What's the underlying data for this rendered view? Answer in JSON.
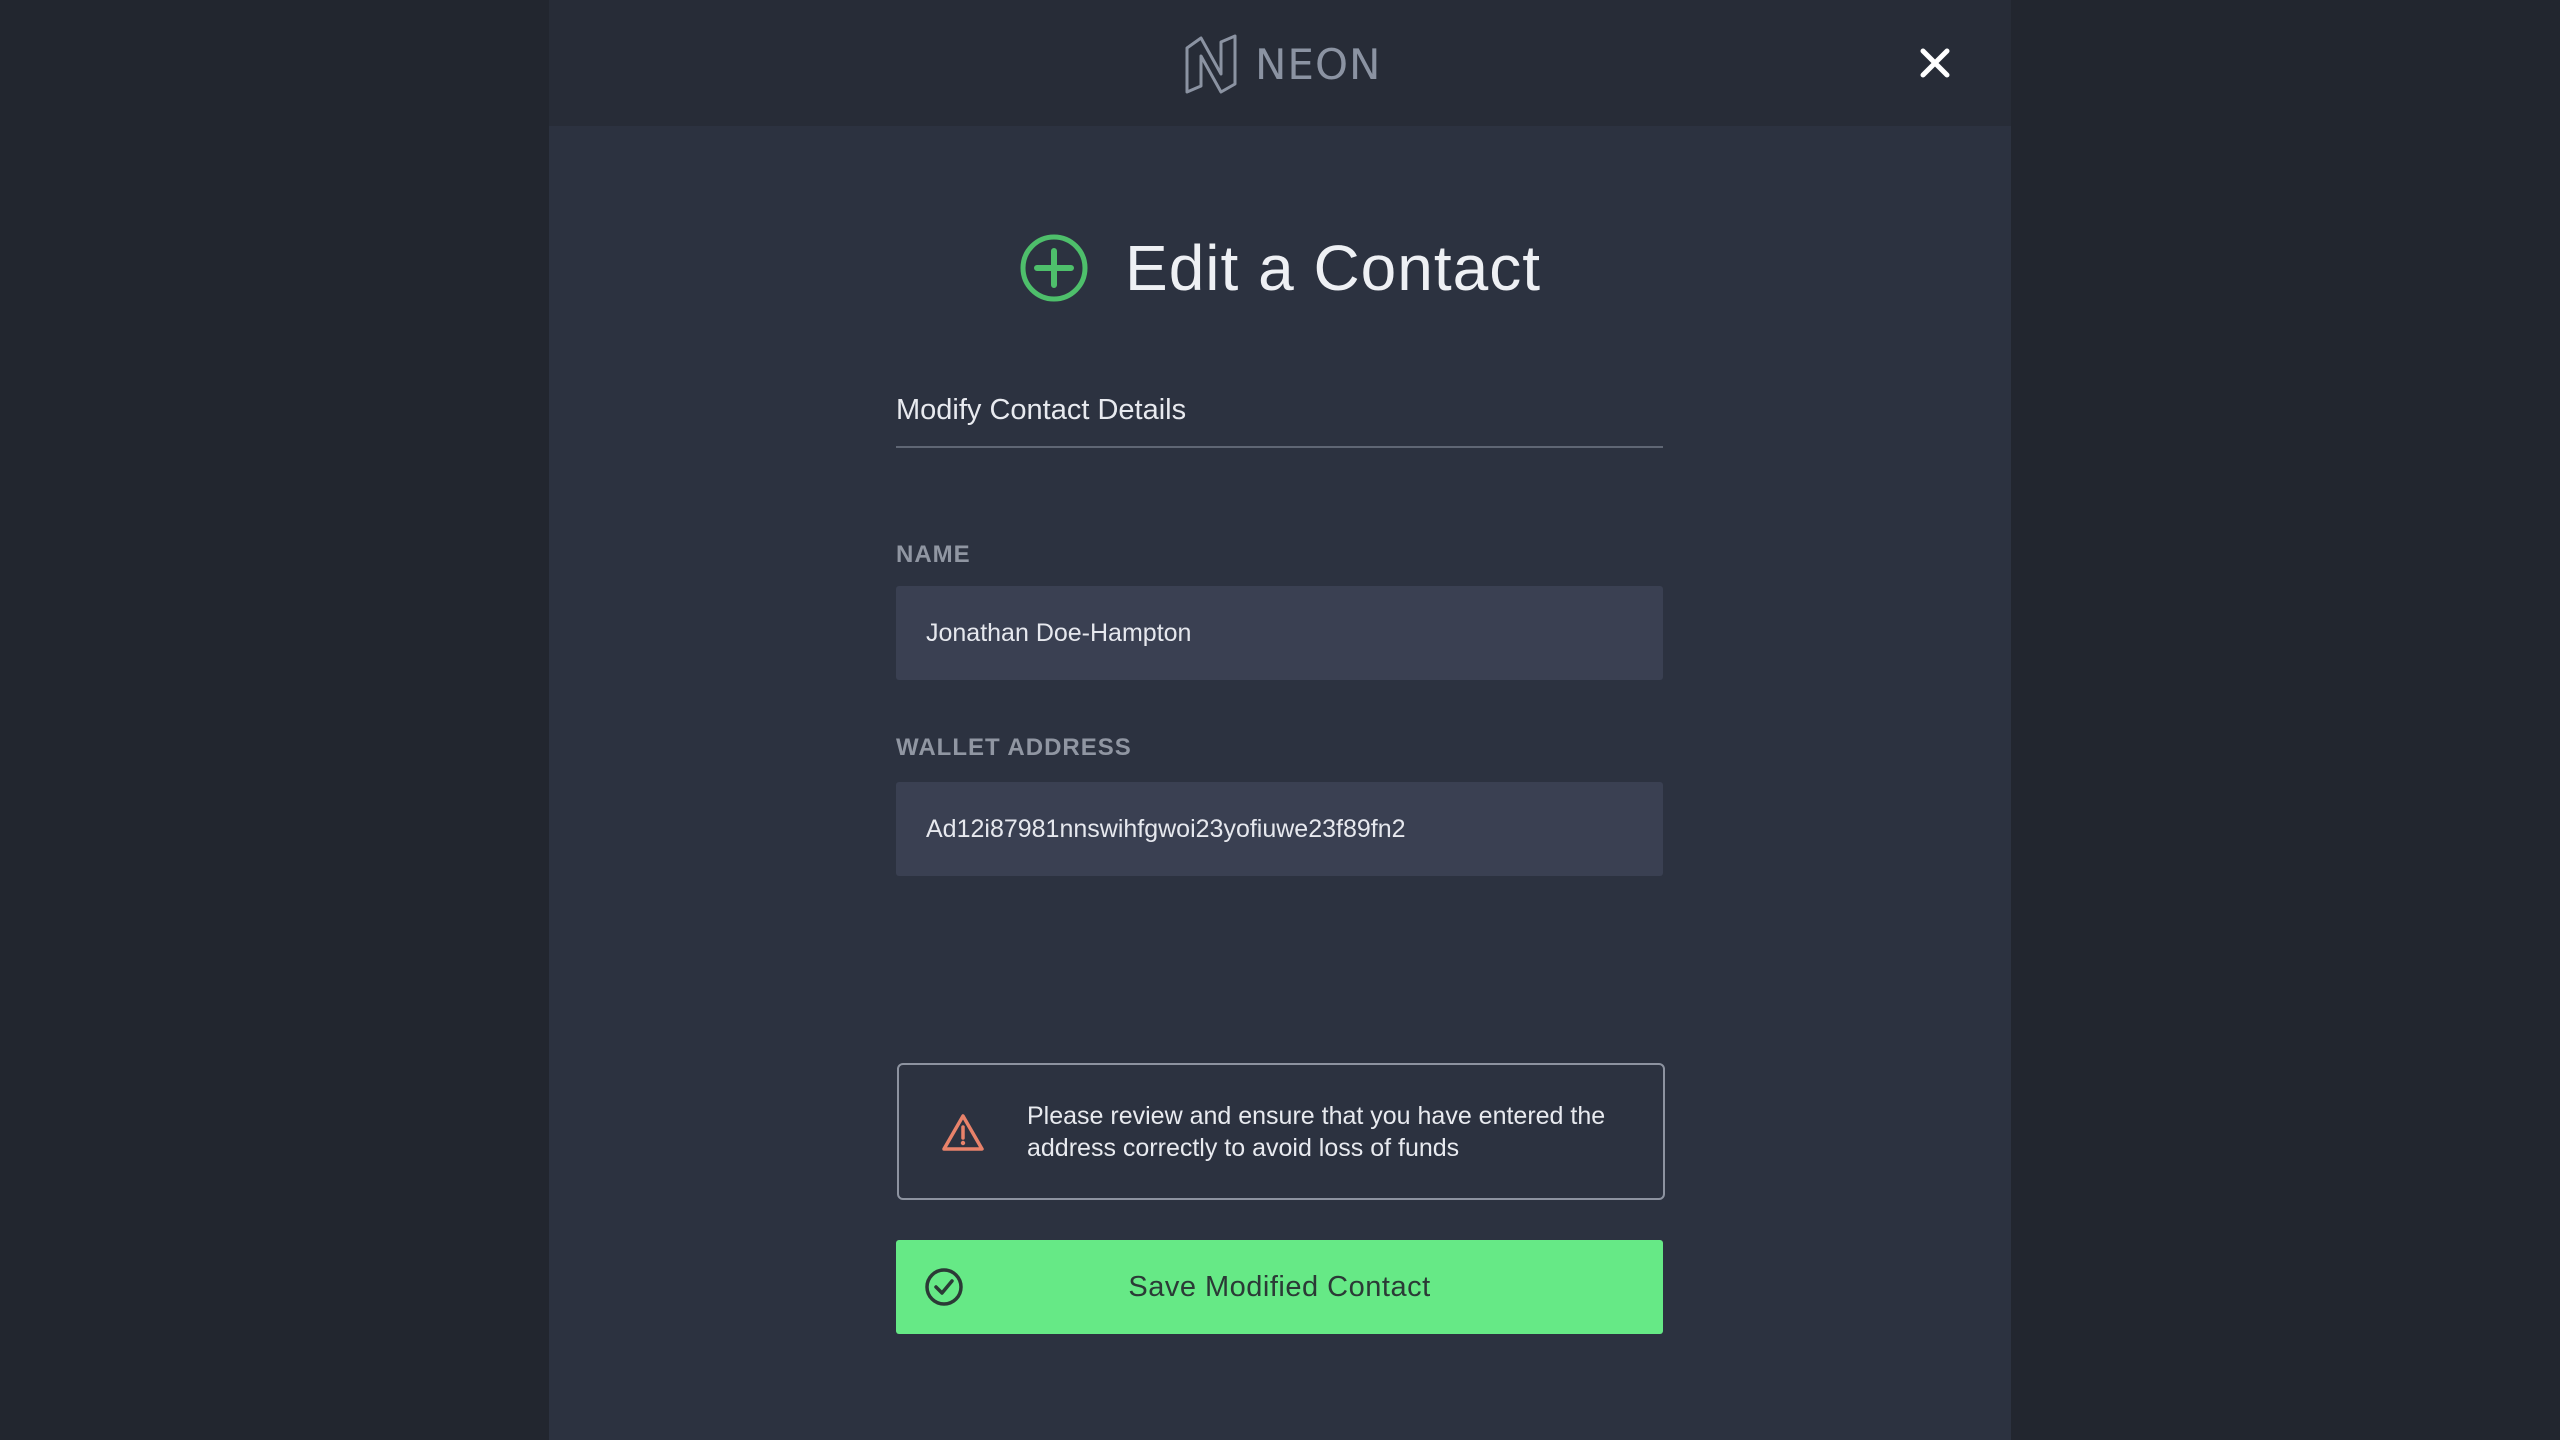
{
  "app": {
    "logo_text": "NEON",
    "close_icon": "close-icon"
  },
  "page": {
    "title": "Edit a Contact",
    "title_icon": "plus-circle-icon",
    "section_title": "Modify Contact Details"
  },
  "form": {
    "name_label": "NAME",
    "name_value": "Jonathan Doe-Hampton",
    "address_label": "WALLET ADDRESS",
    "address_value": "Ad12i87981nnswihfgwoi23yofiuwe23f89fn2"
  },
  "warning": {
    "icon": "warning-triangle-icon",
    "text": "Please review and ensure that you have entered the address correctly to avoid loss of funds"
  },
  "actions": {
    "save_label": "Save Modified Contact",
    "save_icon": "check-circle-icon"
  },
  "colors": {
    "background": "#22262f",
    "panel": "#2c3240",
    "topbar": "#272c37",
    "accent_green": "#4ebf6b",
    "button_green": "#66e986",
    "input_bg": "#3a4052",
    "warning_orange": "#e8826a"
  }
}
